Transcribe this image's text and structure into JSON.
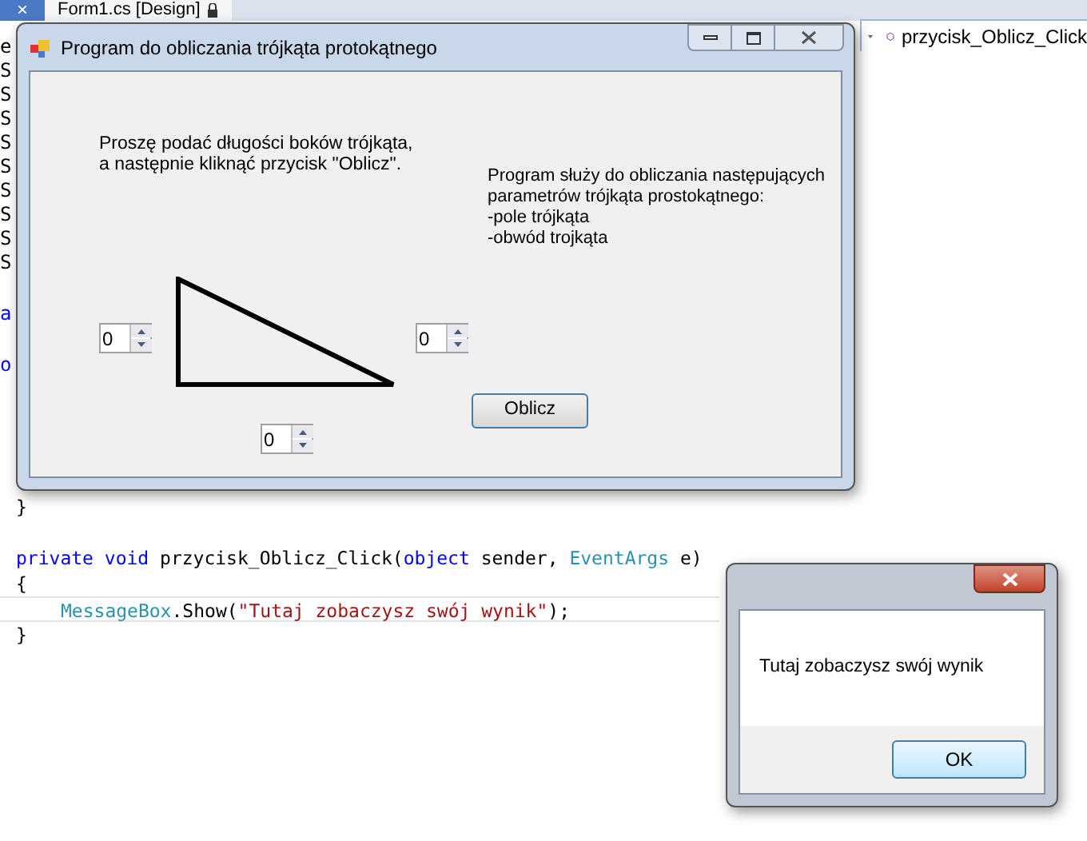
{
  "editor": {
    "tab": {
      "close": "×",
      "title": "Form1.cs [Design]"
    },
    "member_dropdown": "przycisk_Oblicz_Click",
    "left_fragments": [
      {
        "text": "e"
      },
      {
        "text": "S"
      },
      {
        "text": "S"
      },
      {
        "text": "S"
      },
      {
        "text": "S"
      },
      {
        "text": "S"
      },
      {
        "text": "S"
      },
      {
        "text": "S"
      },
      {
        "text": "S"
      },
      {
        "text": "S"
      },
      {
        "text": "a"
      },
      {
        "text": "o"
      }
    ],
    "code_lines": [
      [
        {
          "text": "}",
          "kind": "plain"
        }
      ],
      [
        {
          "text": "private",
          "kind": "keyword"
        },
        {
          "text": " void",
          "kind": "keyword"
        },
        {
          "text": " przycisk_Oblicz_Click(",
          "kind": "plain"
        },
        {
          "text": "object",
          "kind": "keyword"
        },
        {
          "text": " sender, ",
          "kind": "plain"
        },
        {
          "text": "EventArgs",
          "kind": "type"
        },
        {
          "text": " e)",
          "kind": "plain"
        }
      ],
      [
        {
          "text": "{",
          "kind": "plain"
        }
      ],
      [
        {
          "text": "MessageBox",
          "kind": "type"
        },
        {
          "text": ".Show(",
          "kind": "plain"
        },
        {
          "text": "\"Tutaj zobaczysz swój wynik\"",
          "kind": "string"
        },
        {
          "text": ");",
          "kind": "plain"
        }
      ],
      [
        {
          "text": "}",
          "kind": "plain"
        }
      ]
    ]
  },
  "form": {
    "title": "Program do obliczania trójkąta protokątnego",
    "instruction": [
      "Proszę podać długości boków trójkąta,",
      "a następnie kliknąć przycisk \"Oblicz\"."
    ],
    "description": [
      "Program służy do obliczania następujących",
      "parametrów trójkąta prostokątnego:",
      "-pole trójkąta",
      "-obwód trojkąta"
    ],
    "inputs": [
      {
        "value": "0"
      },
      {
        "value": "0"
      },
      {
        "value": "0"
      }
    ],
    "button": "Oblicz"
  },
  "message_box": {
    "text": "Tutaj zobaczysz swój wynik",
    "button": "OK"
  }
}
